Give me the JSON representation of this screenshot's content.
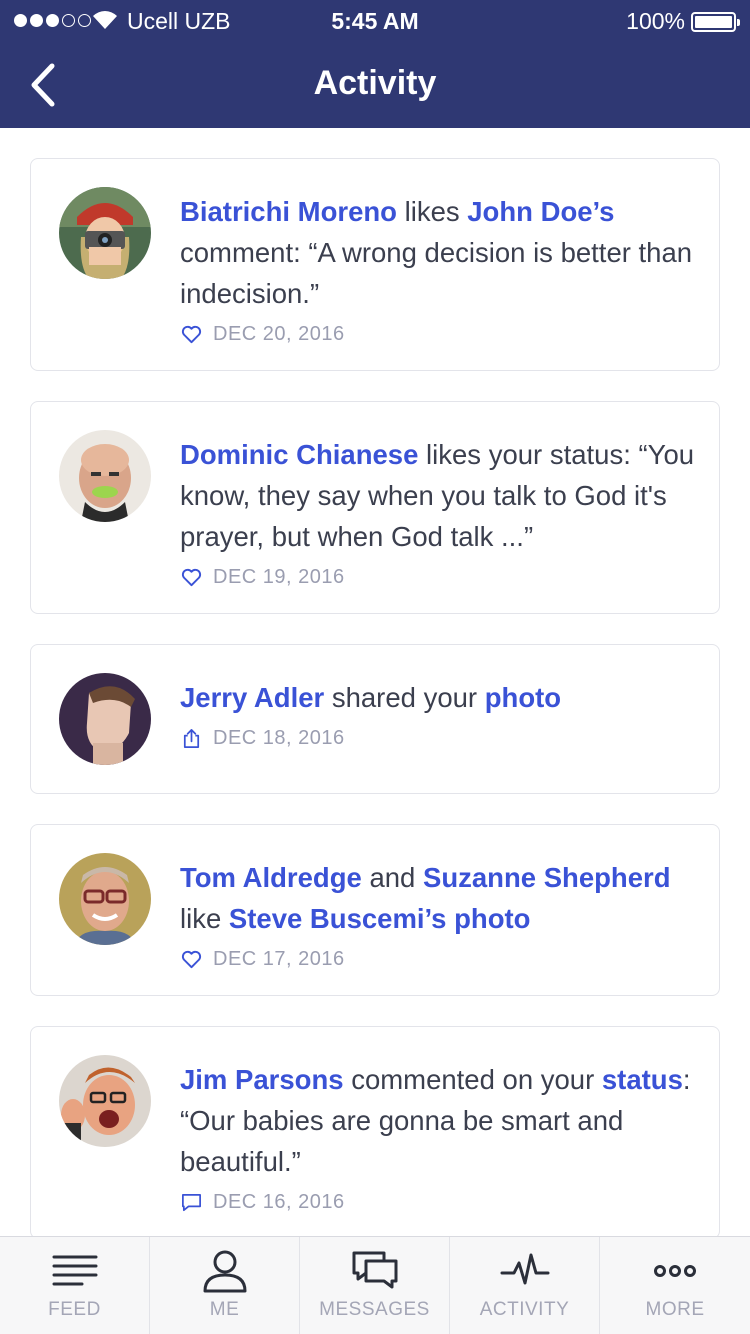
{
  "status_bar": {
    "carrier": "Ucell UZB",
    "time": "5:45 AM",
    "battery": "100%"
  },
  "nav": {
    "title": "Activity"
  },
  "colors": {
    "header": "#2f3873",
    "link": "#3a52d6",
    "muted": "#9a9db0"
  },
  "activities": [
    {
      "name_a": "Biatrichi Moreno",
      "verb": " likes ",
      "name_b": "John Doe’s",
      "rest": "comment: “A wrong decision is better than indecision.”",
      "icon": "heart-icon",
      "date": "DEC 20, 2016"
    },
    {
      "name_a": "Dominic Chianese",
      "rest": " likes your status: “You know, they say when you talk to God it's prayer, but when God talk ...”",
      "icon": "heart-icon",
      "date": "DEC 19, 2016"
    },
    {
      "name_a": "Jerry Adler",
      "verb": " shared your ",
      "name_b": "photo",
      "icon": "share-icon",
      "date": "DEC 18, 2016"
    },
    {
      "name_a": "Tom Aldredge",
      "verb": " and ",
      "name_b": "Suzanne Shepherd",
      "verb2": " like ",
      "name_c": "Steve Buscemi’s photo",
      "icon": "heart-icon",
      "date": "DEC 17, 2016"
    },
    {
      "name_a": "Jim Parsons",
      "verb": " commented on your ",
      "name_b": "status",
      "rest": ": “Our babies are gonna be smart and beautiful.”",
      "icon": "comment-icon",
      "date": "DEC 16, 2016"
    }
  ],
  "tabs": [
    {
      "label": "FEED",
      "icon": "feed-icon"
    },
    {
      "label": "ME",
      "icon": "user-icon"
    },
    {
      "label": "MESSAGES",
      "icon": "messages-icon"
    },
    {
      "label": "ACTIVITY",
      "icon": "activity-icon"
    },
    {
      "label": "MORE",
      "icon": "more-icon"
    }
  ]
}
